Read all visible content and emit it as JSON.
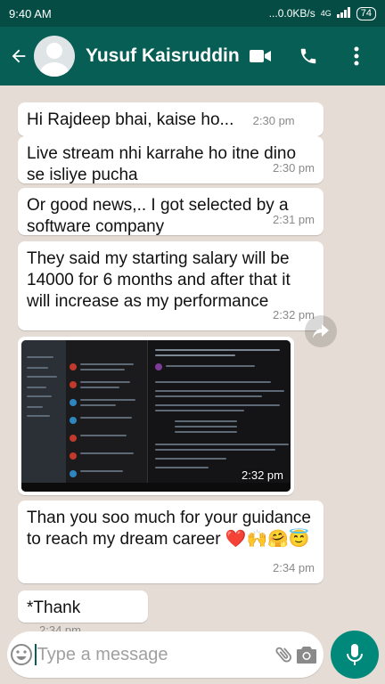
{
  "status_bar": {
    "time": "9:40 AM",
    "network_speed": "...0.0KB/s",
    "network_type": "4G",
    "battery": "74"
  },
  "header": {
    "contact_name": "Yusuf Kaisruddin...",
    "icons": [
      "back-arrow-icon",
      "video-call-icon",
      "phone-icon",
      "more-options-icon"
    ]
  },
  "messages": [
    {
      "text": "Hi Rajdeep bhai, kaise ho...",
      "time": "2:30 pm"
    },
    {
      "text": "Live stream nhi karrahe ho itne dino se isliye pucha",
      "time": "2:30 pm"
    },
    {
      "text": "Or good news,.. I got selected by a software company",
      "time": "2:31 pm"
    },
    {
      "text": "They said my starting salary will be 14000 for 6 months and after that it will increase as my performance",
      "time": "2:32 pm"
    },
    {
      "type": "image",
      "time": "2:32 pm"
    },
    {
      "text": "Than you soo much for your guidance to reach my dream career ❤️🙌🤗😇",
      "time": "2:34 pm"
    },
    {
      "text": "*Thank",
      "time": "2:34 pm"
    }
  ],
  "composer": {
    "placeholder": "Type a message"
  },
  "colors": {
    "header": "#075e54",
    "status_bar": "#054d44",
    "chat_background": "#e5ddd5",
    "mic_button": "#00897b"
  }
}
